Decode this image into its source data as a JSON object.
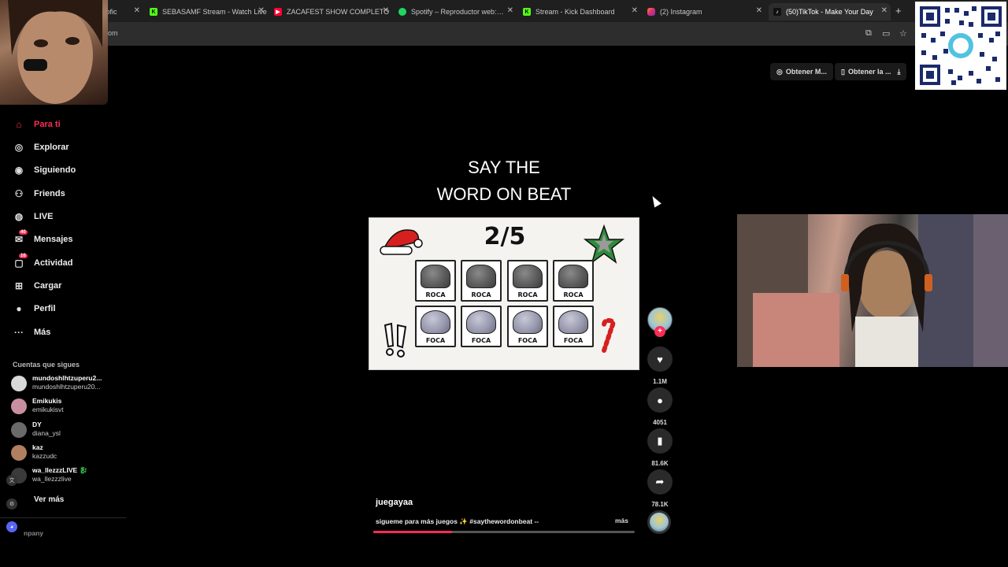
{
  "browser": {
    "tabs": [
      {
        "label": "xofic",
        "icon": "tab-generic-icon",
        "active": false
      },
      {
        "label": "SEBASAMF Stream - Watch Live",
        "icon": "kick-icon",
        "active": false
      },
      {
        "label": "ZACAFEST SHOW COMPLETO",
        "icon": "youtube-icon",
        "active": false
      },
      {
        "label": "Spotify – Reproductor web: mú",
        "icon": "spotify-icon",
        "active": false
      },
      {
        "label": "Stream - Kick Dashboard",
        "icon": "kick-icon",
        "active": false
      },
      {
        "label": "(2) Instagram",
        "icon": "instagram-icon",
        "active": false
      },
      {
        "label": "(50)TikTok - Make Your Day",
        "icon": "tiktok-icon",
        "active": true
      }
    ],
    "new_tab": "+",
    "url_fragment": "om"
  },
  "sidebar": {
    "nav": [
      {
        "label": "Para ti",
        "icon": "home-icon",
        "active": true
      },
      {
        "label": "Explorar",
        "icon": "compass-icon"
      },
      {
        "label": "Siguiendo",
        "icon": "following-icon"
      },
      {
        "label": "Friends",
        "icon": "friends-icon"
      },
      {
        "label": "LIVE",
        "icon": "live-icon"
      },
      {
        "label": "Mensajes",
        "icon": "messages-icon",
        "badge": "40"
      },
      {
        "label": "Actividad",
        "icon": "activity-icon",
        "badge": "16"
      },
      {
        "label": "Cargar",
        "icon": "upload-icon"
      },
      {
        "label": "Perfil",
        "icon": "profile-icon"
      },
      {
        "label": "Más",
        "icon": "more-dots-icon"
      }
    ],
    "following_title": "Cuentas que sigues",
    "following": [
      {
        "name": "mundoshlhtzuperu2...",
        "user": "mundoshlhtzuperu20..."
      },
      {
        "name": "Emikukis",
        "user": "emikukisvt"
      },
      {
        "name": "DY",
        "user": "diana_ysl"
      },
      {
        "name": "kaz",
        "user": "kazzudc"
      },
      {
        "name": "wa_llezzzLIVE 🐉",
        "user": "wa_llezzzlive"
      }
    ],
    "see_more": "Ver más",
    "company": "npany"
  },
  "top_buttons": [
    {
      "label": "Obtener M...",
      "icon": "coin-icon"
    },
    {
      "label": "Obtener la ...",
      "icon": "phone-icon"
    }
  ],
  "video": {
    "title_line1": "SAY THE",
    "title_line2": "WORD ON BEAT",
    "score": "2/5",
    "row1": [
      "ROCA",
      "ROCA",
      "ROCA",
      "ROCA"
    ],
    "row2": [
      "FOCA",
      "FOCA",
      "FOCA",
      "FOCA"
    ],
    "author": "juegayaa",
    "description": "sigueme para más juegos ✨ #saythewordonbeat --",
    "more": "más",
    "progress": 0.3
  },
  "actions": {
    "likes": "1.1M",
    "comments": "4051",
    "saves": "81.6K",
    "shares": "78.1K"
  },
  "colors": {
    "accent": "#fe2c55",
    "background": "#000000"
  }
}
